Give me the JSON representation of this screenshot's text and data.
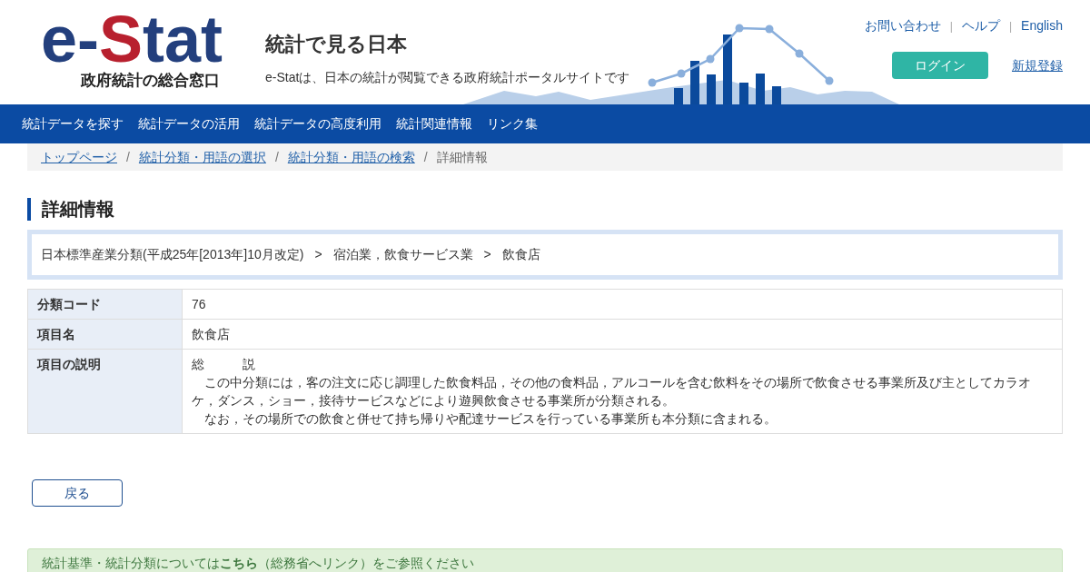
{
  "logo": {
    "parts": [
      {
        "text": "e-",
        "color": "#233f7d"
      },
      {
        "text": "S",
        "color": "#b8202e"
      },
      {
        "text": "tat",
        "color": "#233f7d"
      }
    ],
    "tagline": "政府統計の総合窓口"
  },
  "site": {
    "title": "統計で見る日本",
    "subtitle": "e-Statは、日本の統計が閲覧できる政府統計ポータルサイトです"
  },
  "utility_links": [
    "お問い合わせ",
    "ヘルプ",
    "English"
  ],
  "utility_separator": "|",
  "breadcrumb_separator": "/",
  "path_separator": ">",
  "login_button": "ログイン",
  "register_link": "新規登録",
  "nav": [
    "統計データを探す",
    "統計データの活用",
    "統計データの高度利用",
    "統計関連情報",
    "リンク集"
  ],
  "breadcrumb": [
    {
      "label": "トップページ",
      "current": false
    },
    {
      "label": "統計分類・用語の選択",
      "current": false
    },
    {
      "label": "統計分類・用語の検索",
      "current": false
    },
    {
      "label": "詳細情報",
      "current": true
    }
  ],
  "heading": "詳細情報",
  "classification_path": [
    "日本標準産業分類(平成25年[2013年]10月改定)",
    "宿泊業，飲食サービス業",
    "飲食店"
  ],
  "details": [
    {
      "label": "分類コード",
      "value": [
        "76"
      ]
    },
    {
      "label": "項目名",
      "value": [
        "飲食店"
      ]
    },
    {
      "label": "項目の説明",
      "value": [
        "総　　　説",
        "　この中分類には，客の注文に応じ調理した飲食料品，その他の食料品，アルコールを含む飲料をその場所で飲食させる事業所及び主としてカラオケ，ダンス，ショー，接待サービスなどにより遊興飲食させる事業所が分類される。",
        "　なお，その場所での飲食と併せて持ち帰りや配達サービスを行っている事業所も本分類に含まれる。"
      ]
    }
  ],
  "back_button": "戻る",
  "notice": "統計基準・統計分類については**こちら**（総務省へリンク）をご参照ください"
}
